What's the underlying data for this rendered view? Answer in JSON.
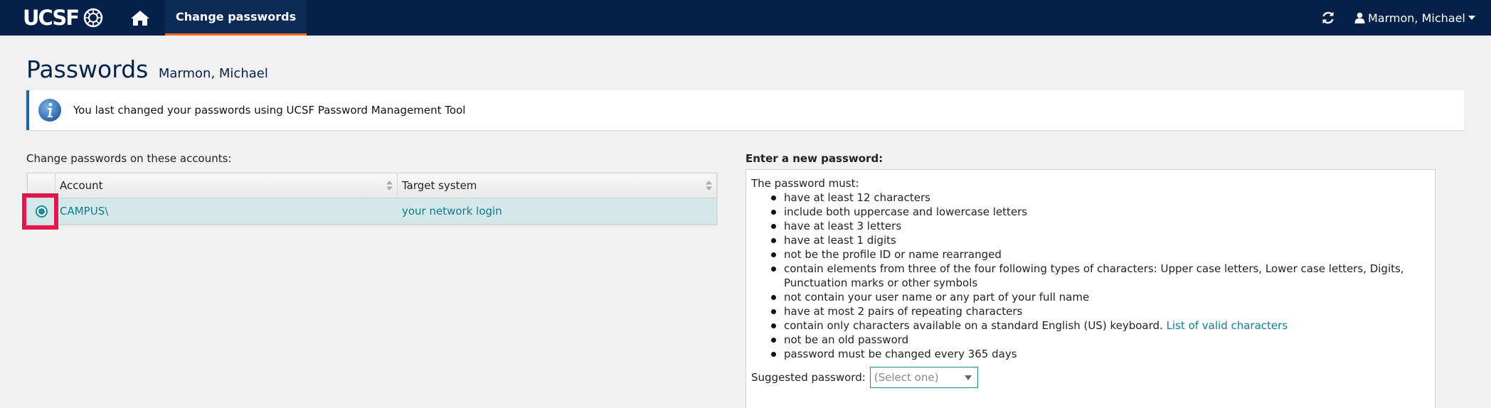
{
  "navbar": {
    "logo_text": "UCSF",
    "tab_label": "Change passwords",
    "user_name": "Marmon, Michael"
  },
  "page": {
    "title": "Passwords",
    "subtitle": "Marmon, Michael"
  },
  "info_banner": {
    "text": "You last changed your passwords using UCSF Password Management Tool"
  },
  "accounts": {
    "section_label": "Change passwords on these accounts:",
    "columns": [
      "Account",
      "Target system"
    ],
    "rows": [
      {
        "account": "CAMPUS\\",
        "target_system": "your network login",
        "selected": true
      }
    ]
  },
  "password_rules": {
    "section_label": "Enter a new password:",
    "intro": "The password must:",
    "rules": [
      "have at least 12 characters",
      "include both uppercase and lowercase letters",
      "have at least 3 letters",
      "have at least 1 digits",
      "not be the profile ID or name rearranged",
      "contain elements from three of the four following types of characters: Upper case letters, Lower case letters, Digits, Punctuation marks or other symbols",
      "not contain your user name or any part of your full name",
      "have at most 2 pairs of repeating characters",
      "contain only characters available on a standard English (US) keyboard.",
      "not be an old password",
      "password must be changed every 365 days"
    ],
    "valid_chars_link": "List of valid characters",
    "suggested_label": "Suggested password:",
    "suggested_value": "(Select one)"
  },
  "colors": {
    "navbar_bg": "#052049",
    "tab_accent": "#f26d21",
    "link_teal": "#0f7d8c",
    "selected_row_bg": "#d4e8ea",
    "highlight": "#e0174f"
  },
  "icons": [
    "home-icon",
    "refresh-icon",
    "user-icon",
    "caret-down-icon",
    "info-icon",
    "sort-icon"
  ]
}
